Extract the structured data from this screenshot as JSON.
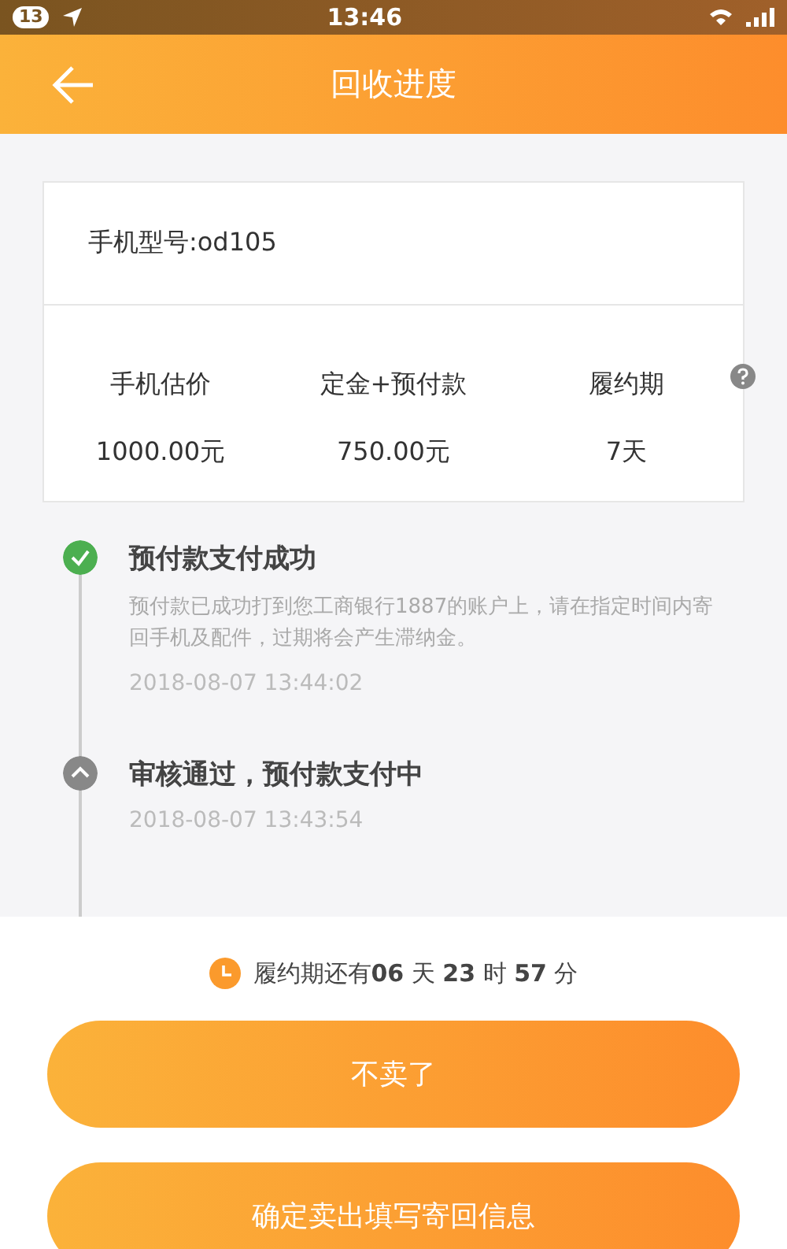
{
  "status_bar": {
    "notification_count": "13",
    "time": "13:46"
  },
  "header": {
    "title": "回收进度"
  },
  "phone": {
    "label": "手机型号:od105"
  },
  "stats": [
    {
      "label": "手机估价",
      "value": "1000.00元",
      "help": false
    },
    {
      "label": "定金+预付款",
      "value": "750.00元",
      "help": false
    },
    {
      "label": "履约期",
      "value": "7天",
      "help": true
    }
  ],
  "timeline": [
    {
      "kind": "done",
      "title": "预付款支付成功",
      "detail": "预付款已成功打到您工商银行1887的账户上，请在指定时间内寄回手机及配件，过期将会产生滞纳金。",
      "time": "2018-08-07 13:44:02"
    },
    {
      "kind": "pending",
      "title": "审核通过，预付款支付中",
      "time": "2018-08-07 13:43:54"
    }
  ],
  "countdown": {
    "text": "履约期还有**06** 天 **23** 时 **57** 分"
  },
  "buttons": [
    "不卖了",
    "确定卖出填写寄回信息"
  ]
}
